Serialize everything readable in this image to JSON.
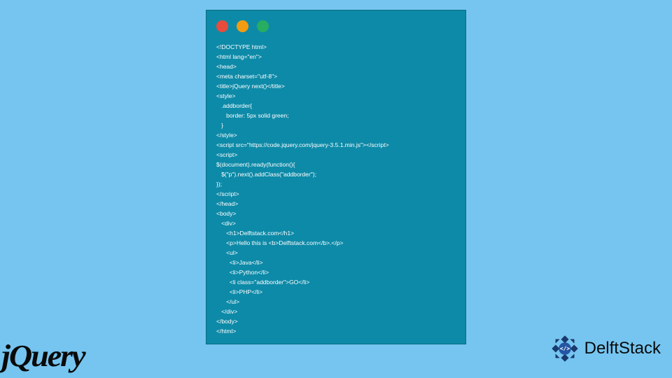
{
  "code_window": {
    "lines": [
      "<!DOCTYPE html>",
      "<html lang=\"en\">",
      "<head>",
      "<meta charset=\"utf-8\">",
      "<title>jQuery next()</title>",
      "<style>",
      "   .addborder{",
      "      border: 5px solid green;",
      "   }",
      "</style>",
      "<script src=\"https://code.jquery.com/jquery-3.5.1.min.js\"></script>",
      "<script>",
      "$(document).ready(function(){",
      "   $(\"p\").next().addClass(\"addborder\");",
      "});",
      "</script>",
      "</head>",
      "<body>",
      "   <div>",
      "      <h1>Delftstack.com</h1>",
      "      <p>Hello this is <b>Delftstack.com</b>.</p>",
      "      <ul>",
      "        <li>Java</li>",
      "        <li>Python</li>",
      "        <li class=\"addborder\">GO</li>",
      "        <li>PHP</li>",
      "      </ul>",
      "   </div>",
      "</body>",
      "</html>"
    ]
  },
  "logos": {
    "jquery": "jQuery",
    "delftstack": "DelftStack"
  }
}
